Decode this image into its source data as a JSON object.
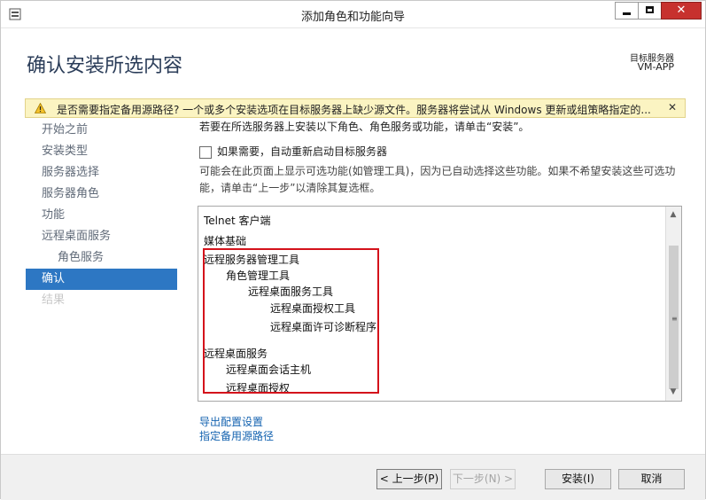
{
  "window": {
    "title": "添加角色和功能向导"
  },
  "header": {
    "page_title": "确认安装所选内容",
    "destination_label": "目标服务器",
    "destination_server": "VM-APP"
  },
  "warning": {
    "text": "是否需要指定备用源路径? 一个或多个安装选项在目标服务器上缺少源文件。服务器将尝试从 Windows 更新或组策略指定的...",
    "close": "✕"
  },
  "nav": [
    {
      "label": "开始之前"
    },
    {
      "label": "安装类型"
    },
    {
      "label": "服务器选择"
    },
    {
      "label": "服务器角色"
    },
    {
      "label": "功能"
    },
    {
      "label": "远程桌面服务"
    },
    {
      "label": "角色服务"
    },
    {
      "label": "确认"
    },
    {
      "label": "结果"
    }
  ],
  "content": {
    "intro": "若要在所选服务器上安装以下角色、角色服务或功能，请单击“安装”。",
    "restart_label": "如果需要，自动重新启动目标服务器",
    "restart_checked": false,
    "note": "可能会在此页面上显示可选功能(如管理工具)，因为已自动选择这些功能。如果不希望安装这些可选功能，请单击“上一步”以清除其复选框。"
  },
  "install_list": [
    {
      "label": "Telnet 客户端"
    },
    {
      "label": "媒体基础"
    },
    {
      "label": "远程服务器管理工具"
    },
    {
      "label": "角色管理工具"
    },
    {
      "label": "远程桌面服务工具"
    },
    {
      "label": "远程桌面授权工具"
    },
    {
      "label": "远程桌面许可诊断程序"
    },
    {
      "label": "远程桌面服务"
    },
    {
      "label": "远程桌面会话主机"
    },
    {
      "label": "远程桌面授权"
    }
  ],
  "links": {
    "export": "导出配置设置",
    "alt_source": "指定备用源路径"
  },
  "buttons": {
    "previous": "< 上一步(P)",
    "next": "下一步(N) >",
    "install": "安装(I)",
    "cancel": "取消"
  },
  "colors": {
    "accent": "#2d77c3",
    "warning_bg": "#fbf4c2",
    "highlight": "#d4121b",
    "link": "#1563b0"
  }
}
